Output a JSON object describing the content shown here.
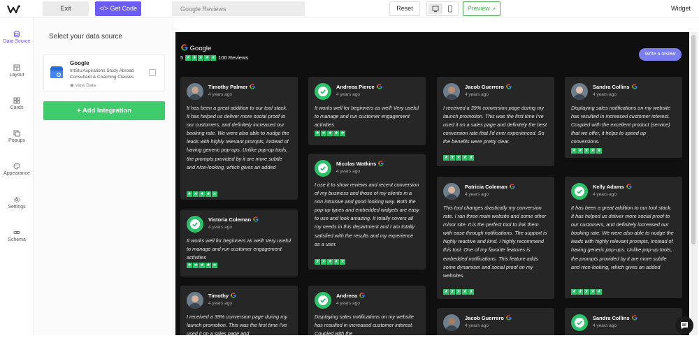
{
  "toolbar": {
    "exit_label": "Exit",
    "get_code_label": "</> Get Code",
    "title_value": "Google Reviews",
    "reset_label": "Reset",
    "preview_label": "Preview",
    "widget_label": "Widget"
  },
  "sidebar": {
    "items": [
      {
        "label": "Data Source",
        "icon": "database-icon",
        "active": true
      },
      {
        "label": "Layout",
        "icon": "layout-icon"
      },
      {
        "label": "Cards",
        "icon": "cards-icon"
      },
      {
        "label": "Popups",
        "icon": "popups-icon"
      },
      {
        "label": "Appearance",
        "icon": "palette-icon"
      },
      {
        "label": "Settings",
        "icon": "gear-icon"
      },
      {
        "label": "Schema",
        "icon": "link-icon"
      }
    ]
  },
  "panel": {
    "title": "Select your data source",
    "source": {
      "name": "Google",
      "description": "IntStu Aspirations Study Abroad Consultant & Coaching Classes",
      "view_label": "View Data"
    },
    "add_button": "+ Add Integration"
  },
  "widget": {
    "brand": "Google",
    "rating": "5",
    "review_count": "100 Reviews",
    "write_review": "Write a review",
    "accent": "#2bc36a"
  },
  "reviews": [
    {
      "name": "Timothy Palmer",
      "time": "4 years ago",
      "avatar": "photo",
      "text": "It has been a great addition to our tool stack. It has helped us deliver more social proof to our customers, and definitely increased our booking rate. We were also able to nudge the leads with highly relevant prompts, instead of having generic pop-ups. Unlike pop-up tools, the prompts provided by it are more subtle and nice-looking, which gives an added"
    },
    {
      "name": "Victoria Coleman",
      "time": "4 years ago",
      "avatar": "check",
      "text": "It works well for beginners as well! Very useful to manage and run customer engagement activities"
    },
    {
      "name": "Timothy",
      "time": "4 years ago",
      "avatar": "photo",
      "text": "I received a 39% conversion page during my launch promotion. This was the first time I've used it on a sales page and"
    },
    {
      "name": "Andreea Pierce",
      "time": "4 years ago",
      "avatar": "check",
      "text": "It works well for beginners as well! Very useful to manage and run customer engagement activities"
    },
    {
      "name": "Nicolas Watkins",
      "time": "4 years ago",
      "avatar": "check",
      "text": "I use it to show reviews and recent conversion of my business and those of my clients in a non intrusive and good looking way. Both the pop-up types and embedded widgets are easy to use and look amazing. It totally covers all my needs in this department and I am totally satisfied with the results and my experience as a user."
    },
    {
      "name": "Andreea",
      "time": "4 years ago",
      "avatar": "check",
      "text": "Displaying sales notifications on my website has resulted in increased customer interest. Coupled with the"
    },
    {
      "name": "Jacob Guerrero",
      "time": "4 years ago",
      "avatar": "photo",
      "text": "I received a 39% conversion page during my launch promotion. This was the first time I've used it on a sales page and definitely the best conversion rate that I'd ever experienced. So the benefits were pretty clear."
    },
    {
      "name": "Patricia Coleman",
      "time": "4 years ago",
      "avatar": "photo",
      "text": "This tool changes drastically my conversion rate. I ran three main website and some other minor site. It is the perfect tool to link them with ease through notifications. The support is highly reactive and kind. I highly recommend this tool. One of my favorite features is embedded notifications. This feature adds some dynamism and social proof on my websites."
    },
    {
      "name": "Jacob Guerrero",
      "time": "4 years ago",
      "avatar": "photo",
      "text": ""
    },
    {
      "name": "Sandra Collins",
      "time": "4 years ago",
      "avatar": "photo",
      "text": "Displaying sales notifications on my website has resulted in increased customer interest. Coupled with the excellent product (service) that we offer, it helps to speed up conversions."
    },
    {
      "name": "Kelly Adams",
      "time": "4 years ago",
      "avatar": "check",
      "text": "It has been a great addition to our tool stack. It has helped us deliver more social proof to our customers, and definitely increased our booking rate. We were also able to nudge the leads with highly relevant prompts, instead of having generic pop-ups. Unlike pop-up tools, the prompts provided by it are more subtle and nice-looking, which gives an added"
    },
    {
      "name": "Sandra Collins",
      "time": "4 years ago",
      "avatar": "check",
      "text": ""
    }
  ]
}
